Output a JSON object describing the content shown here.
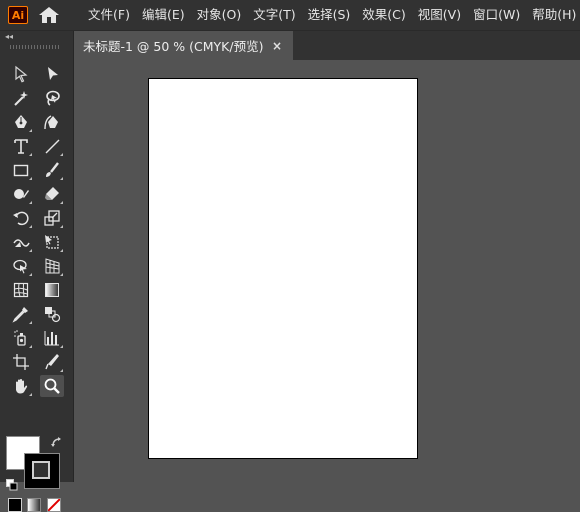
{
  "app": {
    "logo_text": "Ai",
    "home_icon": "home-icon"
  },
  "menu": {
    "items": [
      {
        "label": "文件(F)"
      },
      {
        "label": "编辑(E)"
      },
      {
        "label": "对象(O)"
      },
      {
        "label": "文字(T)"
      },
      {
        "label": "选择(S)"
      },
      {
        "label": "效果(C)"
      },
      {
        "label": "视图(V)"
      },
      {
        "label": "窗口(W)"
      },
      {
        "label": "帮助(H)"
      }
    ]
  },
  "document": {
    "tab_title": "未标题-1 @ 50 % (CMYK/预览)",
    "close_glyph": "×"
  },
  "toolbar": {
    "collapse_glyph": "◂◂",
    "tools": [
      {
        "name": "selection-tool-icon"
      },
      {
        "name": "direct-selection-tool-icon"
      },
      {
        "name": "magic-wand-tool-icon"
      },
      {
        "name": "lasso-tool-icon"
      },
      {
        "name": "pen-tool-icon"
      },
      {
        "name": "curvature-tool-icon"
      },
      {
        "name": "type-tool-icon"
      },
      {
        "name": "line-segment-tool-icon"
      },
      {
        "name": "rectangle-tool-icon"
      },
      {
        "name": "paintbrush-tool-icon"
      },
      {
        "name": "shaper-tool-icon"
      },
      {
        "name": "eraser-tool-icon"
      },
      {
        "name": "rotate-tool-icon"
      },
      {
        "name": "scale-tool-icon"
      },
      {
        "name": "width-tool-icon"
      },
      {
        "name": "free-transform-tool-icon"
      },
      {
        "name": "shape-builder-tool-icon"
      },
      {
        "name": "perspective-grid-tool-icon"
      },
      {
        "name": "mesh-tool-icon"
      },
      {
        "name": "gradient-tool-icon"
      },
      {
        "name": "eyedropper-tool-icon"
      },
      {
        "name": "blend-tool-icon"
      },
      {
        "name": "symbol-sprayer-tool-icon"
      },
      {
        "name": "column-graph-tool-icon"
      },
      {
        "name": "artboard-tool-icon"
      },
      {
        "name": "slice-tool-icon"
      },
      {
        "name": "hand-tool-icon"
      },
      {
        "name": "zoom-tool-icon"
      }
    ],
    "active_tool": "zoom-tool-icon",
    "fill_color": "#ffffff",
    "stroke_color": "#000000"
  },
  "colors": {
    "app_bg": "#535353",
    "panel_bg": "#323232",
    "logo_accent": "#ff7c00",
    "artboard": "#ffffff"
  }
}
